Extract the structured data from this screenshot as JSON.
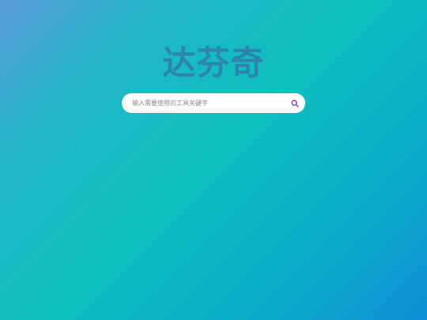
{
  "logo": {
    "text": "达芬奇"
  },
  "search": {
    "placeholder": "输入需要使用的工具关键字",
    "value": "",
    "button_icon": "search-icon"
  },
  "colors": {
    "logo": "#2c84ad",
    "search_icon": "#8b2fb0",
    "gradient_start": "#5b9bd9",
    "gradient_mid": "#0dbfbf",
    "gradient_end": "#0f8fd8"
  }
}
